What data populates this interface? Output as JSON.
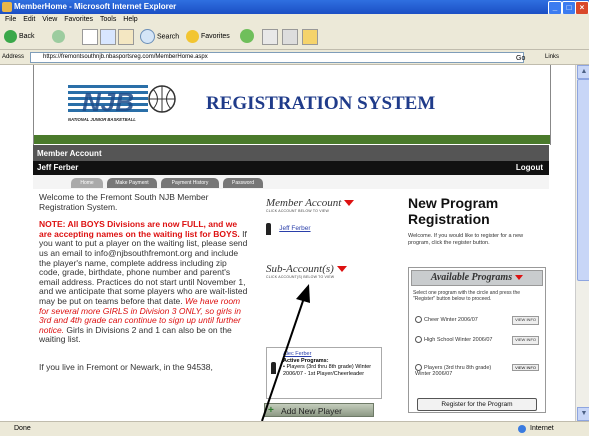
{
  "window": {
    "title": "MemberHome - Microsoft Internet Explorer",
    "btn_min": "_",
    "btn_max": "□",
    "btn_close": "×"
  },
  "menu": [
    "File",
    "Edit",
    "View",
    "Favorites",
    "Tools",
    "Help"
  ],
  "toolbar": {
    "back": "Back",
    "search": "Search",
    "favorites": "Favorites"
  },
  "address": {
    "label": "Address",
    "url": "https://fremontsouthnjb.nbasportsreg.com/MemberHome.aspx",
    "go": "Go",
    "links": "Links"
  },
  "status": {
    "left": "Done",
    "right": "Internet"
  },
  "site": {
    "title": "REGISTRATION SYSTEM",
    "logo_text": "NJB",
    "logo_caption": "NATIONAL JUNIOR BASKETBALL",
    "account_bar": "Member Account",
    "user": "Jeff Ferber",
    "logout": "Logout",
    "tabs": [
      "Home",
      "Make Payment",
      "Payment History",
      "Password"
    ]
  },
  "col1": {
    "p1": "Welcome to the Fremont South NJB Member Registration System.",
    "note_red": "NOTE: All BOYS Divisions are now FULL, and we are accepting names on the waiting list for BOYS.",
    "note_rest": " If you want to put a player on the waiting list, please send us an email to info@njbsouthfremont.org and include the player's name, complete address including zip code, grade, birthdate, phone number and parent's email address. Practices do not start until November 1, and we anticipate that some players who are wait-listed may be put on teams before that date. ",
    "note_italic": "We have room for several more GIRLS in Division 3 ONLY, so girls in 3rd and 4th grade can continue to sign up until further notice.",
    "note_end": " Girls in Divisions 2 and 1 can also be on the waiting list.",
    "p3": "If you live in Fremont or Newark, in the 94538,"
  },
  "col2": {
    "member_head": "Member Account",
    "member_caption": "CLICK ACCOUNT BELOW TO VIEW",
    "member_link": "Jeff Ferber",
    "sub_head": "Sub-Account(s)",
    "sub_caption": "CLICK ACCOUNT(S) BELOW TO VIEW",
    "sub_link": "Alec Ferber",
    "sub_programs_label": "Active Programs:",
    "sub_program": "• Players (3rd thru 8th grade) Winter 2006/07 - 1st Player/Cheerleader",
    "add_btn": "Add New Player"
  },
  "col3": {
    "title": "New Program Registration",
    "desc": "Welcome. If you would like to register for a new program, click the register button.",
    "ap_head": "Available Programs",
    "ap_desc": "Select one program with the circle and press the \"Register\" button below to proceed.",
    "programs": [
      "Cheer Winter 2006/07",
      "High School Winter 2006/07",
      "Players (3rd thru 8th grade) Winter 2006/07"
    ],
    "view_info": "VIEW INFO",
    "register_btn": "Register for the Program"
  }
}
